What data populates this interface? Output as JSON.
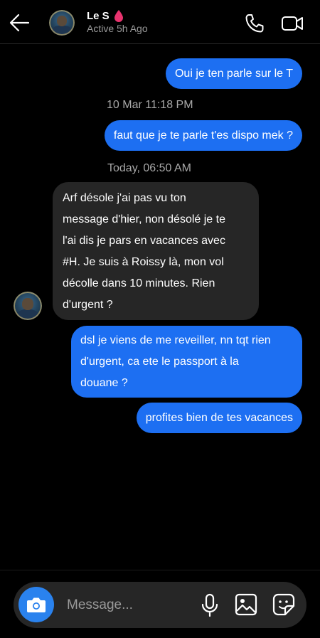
{
  "header": {
    "contact_name": "Le S",
    "status": "Active 5h Ago",
    "name_emoji_icon": "pink-drop-icon"
  },
  "messages": [
    {
      "type": "sent",
      "text": "Oui je ten parle sur le T"
    },
    {
      "type": "timestamp",
      "text": "10 Mar 11:18 PM"
    },
    {
      "type": "sent",
      "text": "faut que je te parle t'es dispo mek ?"
    },
    {
      "type": "timestamp",
      "text": "Today, 06:50 AM"
    },
    {
      "type": "received",
      "lines": [
        "Arf désole j'ai pas vu ton",
        "message d'hier, non désolé je te",
        "l'ai dis je pars en vacances avec",
        "#H. Je suis à Roissy là, mon vol",
        "décolle dans 10 minutes. Rien",
        "d'urgent ?"
      ]
    },
    {
      "type": "sent",
      "lines": [
        "dsl je viens de me reveiller, nn tqt rien",
        "d'urgent, ca ete le passport à la",
        "douane ?"
      ]
    },
    {
      "type": "sent",
      "text": "profites bien de tes vacances"
    }
  ],
  "composer": {
    "placeholder": "Message..."
  },
  "colors": {
    "sent_bubble": "#1d6ff2",
    "received_bubble": "#262626",
    "background": "#000000"
  }
}
